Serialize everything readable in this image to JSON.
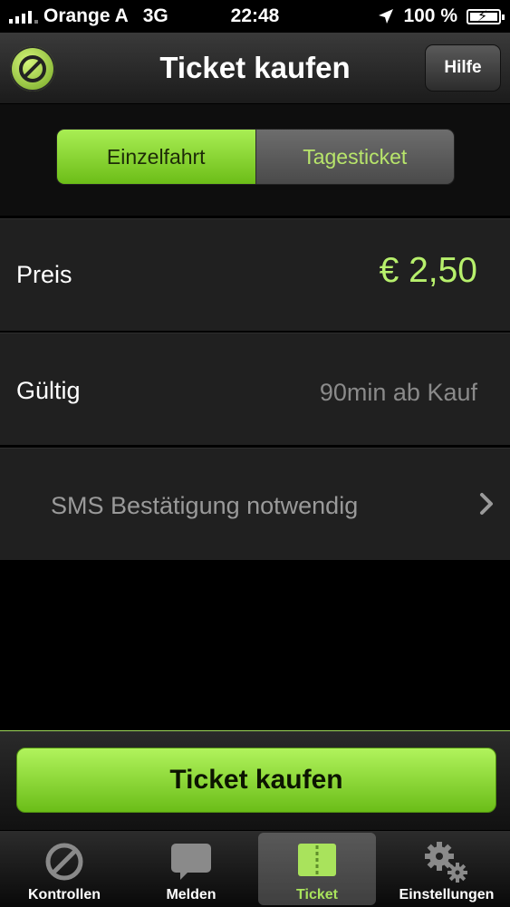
{
  "status_bar": {
    "carrier": "Orange A",
    "network": "3G",
    "time": "22:48",
    "battery_percent": "100 %"
  },
  "navbar": {
    "title": "Ticket kaufen",
    "help_label": "Hilfe"
  },
  "segments": [
    {
      "label": "Einzelfahrt",
      "selected": true
    },
    {
      "label": "Tagesticket",
      "selected": false
    }
  ],
  "rows": {
    "price": {
      "label": "Preis",
      "value": "€ 2,50"
    },
    "valid": {
      "label": "Gültig",
      "value": "90min ab Kauf"
    },
    "sms": {
      "label": "SMS Bestätigung notwendig"
    }
  },
  "buy_button": {
    "label": "Ticket kaufen"
  },
  "tabs": [
    {
      "label": "Kontrollen",
      "icon": "no-entry-icon"
    },
    {
      "label": "Melden",
      "icon": "speech-bubble-icon"
    },
    {
      "label": "Ticket",
      "icon": "ticket-icon",
      "selected": true
    },
    {
      "label": "Einstellungen",
      "icon": "gears-icon"
    }
  ],
  "colors": {
    "accent_green": "#8fd63a",
    "price_green": "#b7f06c",
    "background": "#000000"
  }
}
